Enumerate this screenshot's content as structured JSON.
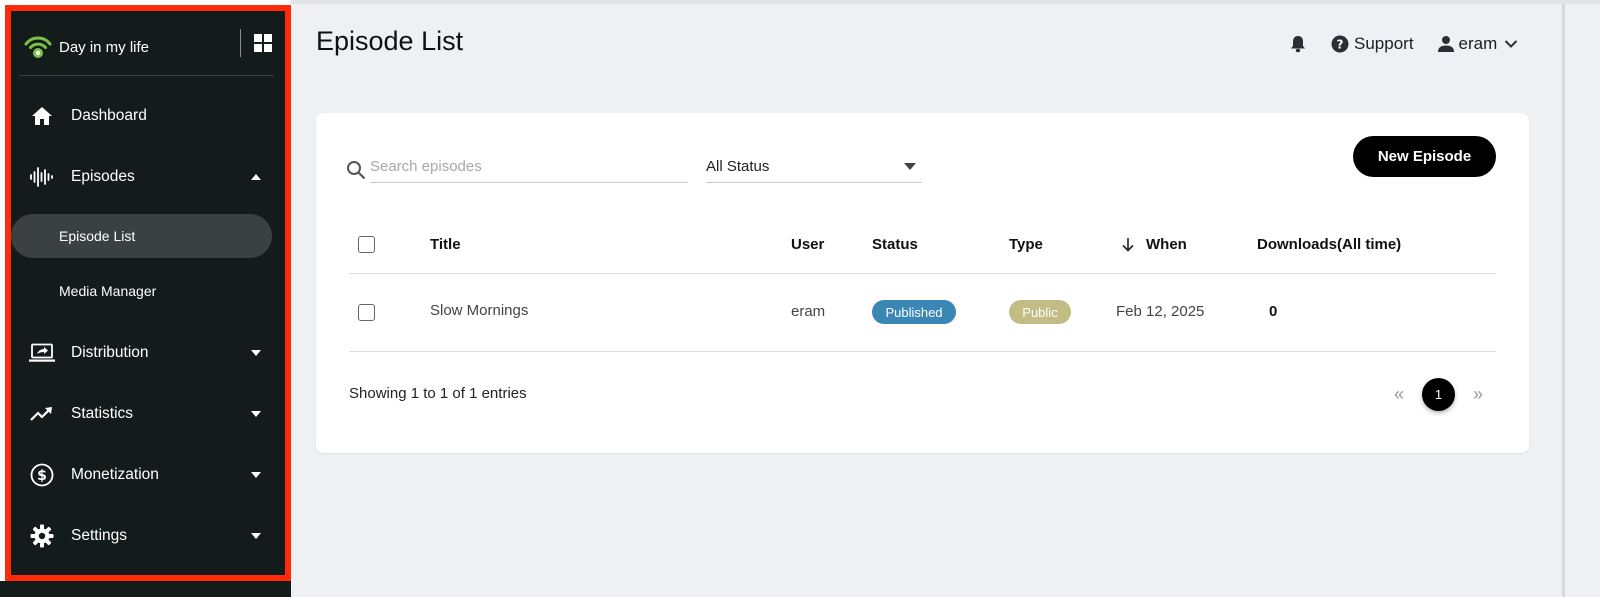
{
  "app": {
    "name": "Day in my life"
  },
  "sidebar": {
    "items": [
      {
        "label": "Dashboard",
        "icon": "home-icon"
      },
      {
        "label": "Episodes",
        "icon": "waveform-icon",
        "expanded": true,
        "children": [
          {
            "label": "Episode List",
            "active": true
          },
          {
            "label": "Media Manager",
            "active": false
          }
        ]
      },
      {
        "label": "Distribution",
        "icon": "laptop-share-icon"
      },
      {
        "label": "Statistics",
        "icon": "trending-up-icon"
      },
      {
        "label": "Monetization",
        "icon": "dollar-circle-icon"
      },
      {
        "label": "Settings",
        "icon": "gear-icon"
      }
    ]
  },
  "header": {
    "title": "Episode List",
    "support_label": "Support",
    "user_name": "eram"
  },
  "toolbar": {
    "search_placeholder": "Search episodes",
    "status_filter": "All Status",
    "new_button": "New Episode"
  },
  "table": {
    "columns": [
      "Title",
      "User",
      "Status",
      "Type",
      "When",
      "Downloads(All time)"
    ],
    "sort_column": "When",
    "rows": [
      {
        "title": "Slow Mornings",
        "user": "eram",
        "status": "Published",
        "type": "Public",
        "when": "Feb 12, 2025",
        "downloads": "0"
      }
    ]
  },
  "pagination": {
    "summary": "Showing 1 to 1 of 1 entries",
    "prev": "«",
    "current_page": "1",
    "next": "»"
  },
  "colors": {
    "sidebar_bg": "#131c1b",
    "highlight_border": "#ff2a0a",
    "published_badge": "#3a86b4",
    "public_badge": "#c2bd85",
    "brand_green": "#7cc242"
  }
}
